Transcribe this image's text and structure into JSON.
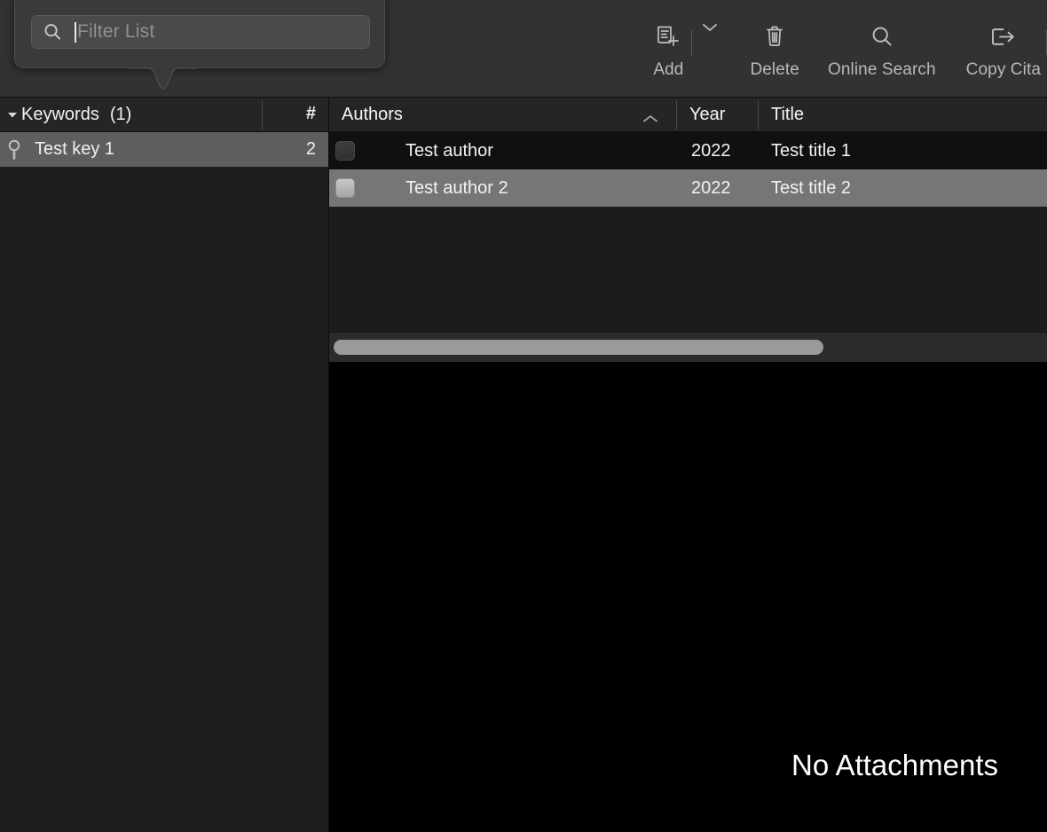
{
  "toolbar": {
    "items": [
      {
        "label": "Add",
        "icon": "document-add-icon",
        "has_dropdown": true
      },
      {
        "label": "Delete",
        "icon": "trash-icon",
        "has_dropdown": false
      },
      {
        "label": "Online Search",
        "icon": "search-icon",
        "has_dropdown": false
      },
      {
        "label": "Copy Cita",
        "icon": "export-arrow-icon",
        "has_dropdown": false
      }
    ]
  },
  "filter_popover": {
    "search_icon": "search-icon",
    "placeholder": "Filter List",
    "value": ""
  },
  "sidebar": {
    "header": {
      "disclosure_icon": "triangle-down-icon",
      "title": "Keywords",
      "count": "(1)",
      "count_column_header": "#"
    },
    "rows": [
      {
        "icon": "keyword-pin-icon",
        "label": "Test key 1",
        "count": "2",
        "selected": true
      }
    ]
  },
  "table": {
    "columns": [
      {
        "key": "checkbox",
        "label": ""
      },
      {
        "key": "authors",
        "label": "Authors",
        "sort": "ascending",
        "sort_icon": "chevron-up-icon"
      },
      {
        "key": "year",
        "label": "Year"
      },
      {
        "key": "title",
        "label": "Title"
      }
    ],
    "rows": [
      {
        "checked": false,
        "authors": "Test author",
        "year": "2022",
        "title": "Test title 1",
        "selected": false
      },
      {
        "checked": false,
        "authors": "Test author 2",
        "year": "2022",
        "title": "Test title 2",
        "selected": true
      }
    ],
    "horizontal_scrollbar": true
  },
  "attachment_panel": {
    "message": "No Attachments"
  },
  "colors": {
    "toolbar_bg": "#323232",
    "sidebar_bg": "#1e1e1e",
    "header_bg": "#252525",
    "row_selected": "#767676",
    "row_unselected": "#101010",
    "attachment_bg": "#000000",
    "text_primary": "#f2f2f2",
    "text_secondary": "#b9b9b9",
    "scrollbar_thumb": "#9a9a9a"
  }
}
